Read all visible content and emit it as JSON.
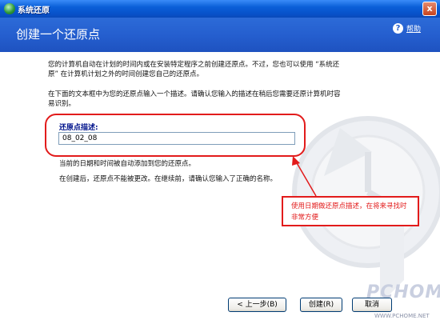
{
  "window": {
    "title": "系统还原",
    "close_glyph": "x"
  },
  "header": {
    "title": "创建一个还原点",
    "help_label": "帮助",
    "help_glyph": "?"
  },
  "content": {
    "para1": "您的计算机自动在计划的时间内或在安装特定程序之前创建还原点。不过，您也可以使用 “系统还原” 在计算机计划之外的时间创建您自己的还原点。",
    "para2": "在下面的文本框中为您的还原点输入一个描述。请确认您输入的描述在稍后您需要还原计算机时容易识别。",
    "field_label": "还原点描述:",
    "field_value": "08_02_08",
    "note1": "当前的日期和时间被自动添加到您的还原点。",
    "note2": "在创建后，还原点不能被更改。在继续前，请确认您输入了正确的名称。"
  },
  "callout": {
    "text": "使用日期做还原点描述，在将来寻找时非常方便"
  },
  "buttons": {
    "back": "< 上一步(B)",
    "create": "创建(R)",
    "cancel": "取消"
  },
  "watermark": {
    "brand": "PCHOME",
    "url": "WWW.PCHOME.NET"
  },
  "colors": {
    "header_blue": "#255fcf",
    "annotation_red": "#e21b1b"
  }
}
